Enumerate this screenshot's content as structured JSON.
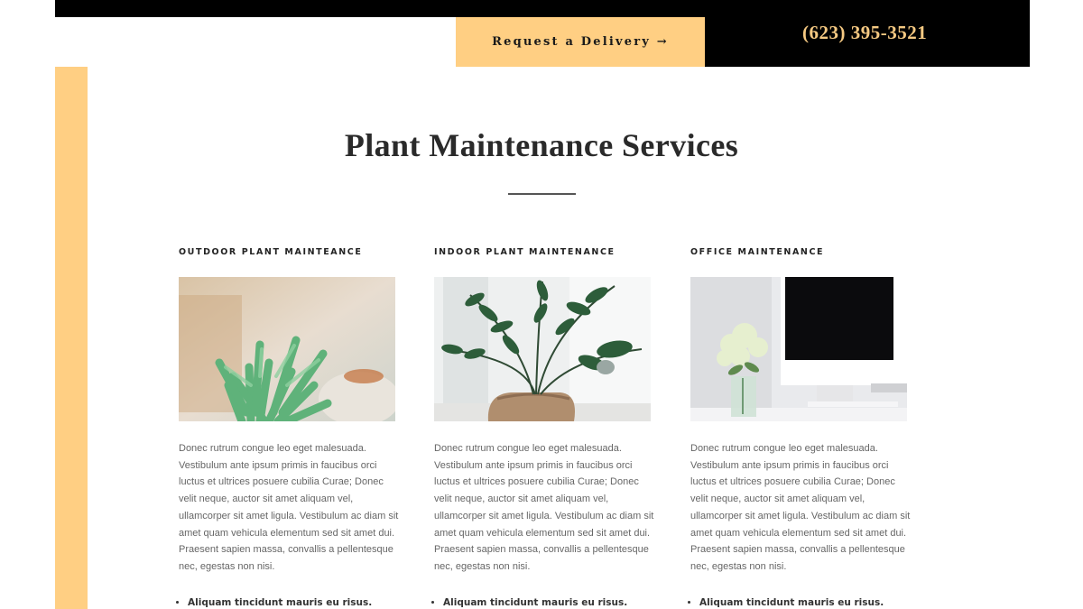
{
  "header": {
    "cta_label": "Request a Delivery →",
    "phone": "(623) 395-3521"
  },
  "section": {
    "title": "Plant Maintenance Services"
  },
  "services": [
    {
      "title": "OUTDOOR PLANT MAINTEANCE",
      "image_subject": "succulent plant photo",
      "body": "Donec rutrum congue leo eget malesuada. Vestibulum ante ipsum primis in faucibus orci luctus et ultrices posuere cubilia Curae; Donec velit neque, auctor sit amet aliquam vel, ullamcorper sit amet ligula. Vestibulum ac diam sit amet quam vehicula elementum sed sit amet dui. Praesent sapien massa, convallis a pellentesque nec, egestas non nisi.",
      "list": [
        "Aliquam tincidunt mauris eu risus."
      ]
    },
    {
      "title": "INDOOR PLANT MAINTENANCE",
      "image_subject": "potted zz plant photo",
      "body": "Donec rutrum congue leo eget malesuada. Vestibulum ante ipsum primis in faucibus orci luctus et ultrices posuere cubilia Curae; Donec velit neque, auctor sit amet aliquam vel, ullamcorper sit amet ligula. Vestibulum ac diam sit amet quam vehicula elementum sed sit amet dui. Praesent sapien massa, convallis a pellentesque nec, egestas non nisi.",
      "list": [
        "Aliquam tincidunt mauris eu risus."
      ]
    },
    {
      "title": "OFFICE MAINTENANCE",
      "image_subject": "office desk with hydrangea and monitor photo",
      "body": "Donec rutrum congue leo eget malesuada. Vestibulum ante ipsum primis in faucibus orci luctus et ultrices posuere cubilia Curae; Donec velit neque, auctor sit amet aliquam vel, ullamcorper sit amet ligula. Vestibulum ac diam sit amet quam vehicula elementum sed sit amet dui. Praesent sapien massa, convallis a pellentesque nec, egestas non nisi.",
      "list": [
        "Aliquam tincidunt mauris eu risus."
      ]
    }
  ],
  "colors": {
    "accent": "#ffcf83",
    "phone_text": "#f5c982",
    "header_dark": "#000000"
  }
}
